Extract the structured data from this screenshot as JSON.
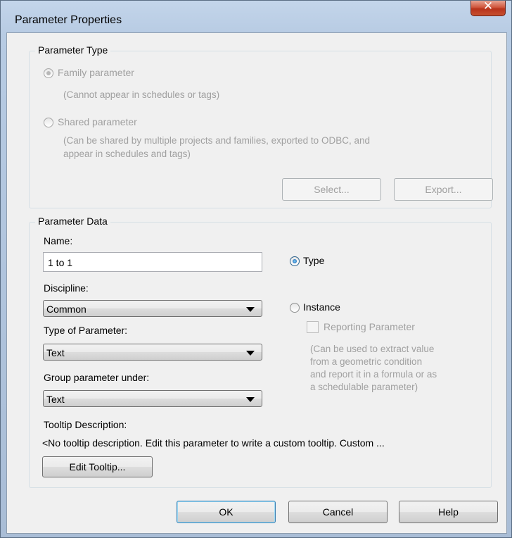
{
  "window": {
    "title": "Parameter Properties"
  },
  "parameter_type": {
    "legend": "Parameter Type",
    "family_label": "Family parameter",
    "family_note": "(Cannot appear in schedules or tags)",
    "shared_label": "Shared parameter",
    "shared_note_1": "(Can be shared by multiple projects and families, exported to ODBC, and",
    "shared_note_2": "appear in schedules and tags)",
    "select_label": "Select...",
    "export_label": "Export..."
  },
  "parameter_data": {
    "legend": "Parameter Data",
    "name_label": "Name:",
    "name_value": "1 to 1",
    "type_label": "Type",
    "discipline_label": "Discipline:",
    "discipline_value": "Common",
    "instance_label": "Instance",
    "type_of_param_label": "Type of Parameter:",
    "type_of_param_value": "Text",
    "reporting_label": "Reporting Parameter",
    "reporting_note_1": "(Can be used to extract value",
    "reporting_note_2": "from a geometric condition",
    "reporting_note_3": "and report it in a formula or as",
    "reporting_note_4": "a schedulable parameter)",
    "group_label": "Group parameter under:",
    "group_value": "Text",
    "tooltip_label": "Tooltip Description:",
    "tooltip_text": "<No tooltip description. Edit this parameter to write a custom tooltip. Custom ...",
    "edit_tooltip_label": "Edit Tooltip..."
  },
  "footer": {
    "ok_label": "OK",
    "cancel_label": "Cancel",
    "help_label": "Help"
  }
}
